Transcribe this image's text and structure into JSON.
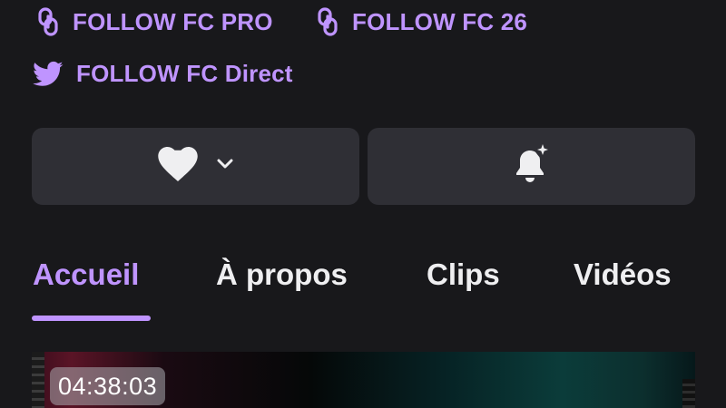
{
  "social_links": {
    "pro": {
      "label": "FOLLOW FC PRO",
      "icon": "link-icon"
    },
    "fc26": {
      "label": "FOLLOW FC 26",
      "icon": "link-icon"
    },
    "direct": {
      "label": "FOLLOW FC Direct",
      "icon": "twitter-icon"
    }
  },
  "actions": {
    "follow": {
      "icon": "heart-icon",
      "dropdown_icon": "chevron-down-icon"
    },
    "notify": {
      "icon": "bell-sparkle-icon"
    }
  },
  "tabs": [
    {
      "label": "Accueil",
      "active": true
    },
    {
      "label": "À propos",
      "active": false
    },
    {
      "label": "Clips",
      "active": false
    },
    {
      "label": "Vidéos",
      "active": false
    }
  ],
  "video": {
    "duration": "04:38:03"
  },
  "colors": {
    "background": "#18181b",
    "accent": "#bf94ff",
    "button": "#2f2f35",
    "text": "#efeff1"
  }
}
